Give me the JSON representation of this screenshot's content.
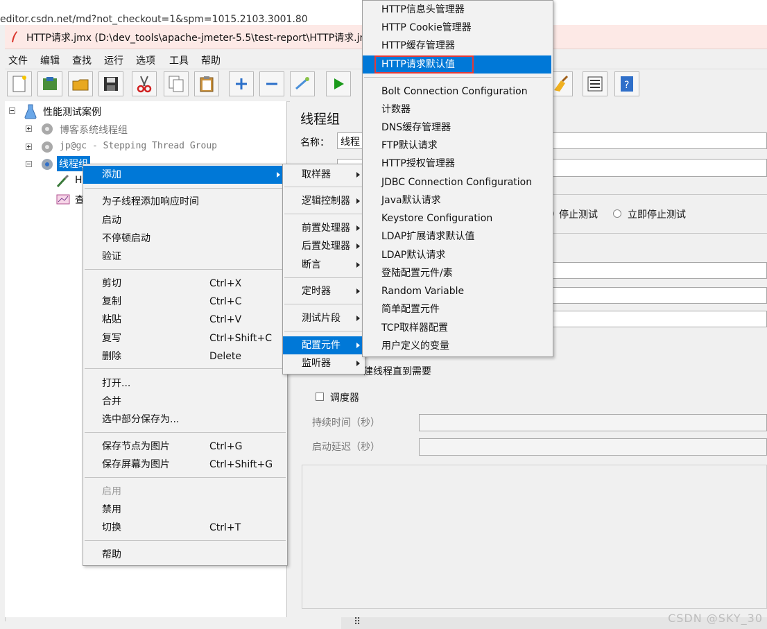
{
  "browser": {
    "url": "editor.csdn.net/md?not_checkout=1&spm=1015.2103.3001.80"
  },
  "window": {
    "title": "HTTP请求.jmx (D:\\dev_tools\\apache-jmeter-5.5\\test-report\\HTTP请求.jmx"
  },
  "menubar": [
    "文件",
    "编辑",
    "查找",
    "运行",
    "选项",
    "工具",
    "帮助"
  ],
  "tree": {
    "root": "性能测试案例",
    "group1": "博客系统线程组",
    "group2": "jp@gc - Stepping Thread Group",
    "group3": "线程组",
    "child1": "H",
    "child2": "查"
  },
  "panel": {
    "title": "线程组",
    "name_label": "名称：",
    "name_value": "线程",
    "stop_test": "停止测试",
    "stop_now": "立即停止测试",
    "thread_until": "建线程直到需要",
    "scheduler": "调度器",
    "duration": "持续时间（秒）",
    "startup_delay": "启动延迟（秒）"
  },
  "context_menu": {
    "add": "添加",
    "add_response_time": "为子线程添加响应时间",
    "start": "启动",
    "start_no_pause": "不停顿启动",
    "validate": "验证",
    "cut": "剪切",
    "cut_key": "Ctrl+X",
    "copy": "复制",
    "copy_key": "Ctrl+C",
    "paste": "粘贴",
    "paste_key": "Ctrl+V",
    "duplicate": "复写",
    "duplicate_key": "Ctrl+Shift+C",
    "delete": "删除",
    "delete_key": "Delete",
    "open": "打开...",
    "merge": "合并",
    "save_selection": "选中部分保存为...",
    "save_node_img": "保存节点为图片",
    "save_node_img_key": "Ctrl+G",
    "save_screen_img": "保存屏幕为图片",
    "save_screen_img_key": "Ctrl+Shift+G",
    "enable": "启用",
    "disable": "禁用",
    "toggle": "切换",
    "toggle_key": "Ctrl+T",
    "help": "帮助"
  },
  "add_submenu": {
    "sampler": "取样器",
    "logic_controller": "逻辑控制器",
    "pre_processor": "前置处理器",
    "post_processor": "后置处理器",
    "assertion": "断言",
    "timer": "定时器",
    "test_fragment": "测试片段",
    "config_element": "配置元件",
    "listener": "监听器"
  },
  "config_submenu": [
    "HTTP信息头管理器",
    "HTTP Cookie管理器",
    "HTTP缓存管理器",
    "HTTP请求默认值",
    "Bolt Connection Configuration",
    "计数器",
    "DNS缓存管理器",
    "FTP默认请求",
    "HTTP授权管理器",
    "JDBC Connection Configuration",
    "Java默认请求",
    "Keystore Configuration",
    "LDAP扩展请求默认值",
    "LDAP默认请求",
    "登陆配置元件/素",
    "Random Variable",
    "简单配置元件",
    "TCP取样器配置",
    "用户定义的变量"
  ],
  "watermark": "CSDN @SKY_30"
}
